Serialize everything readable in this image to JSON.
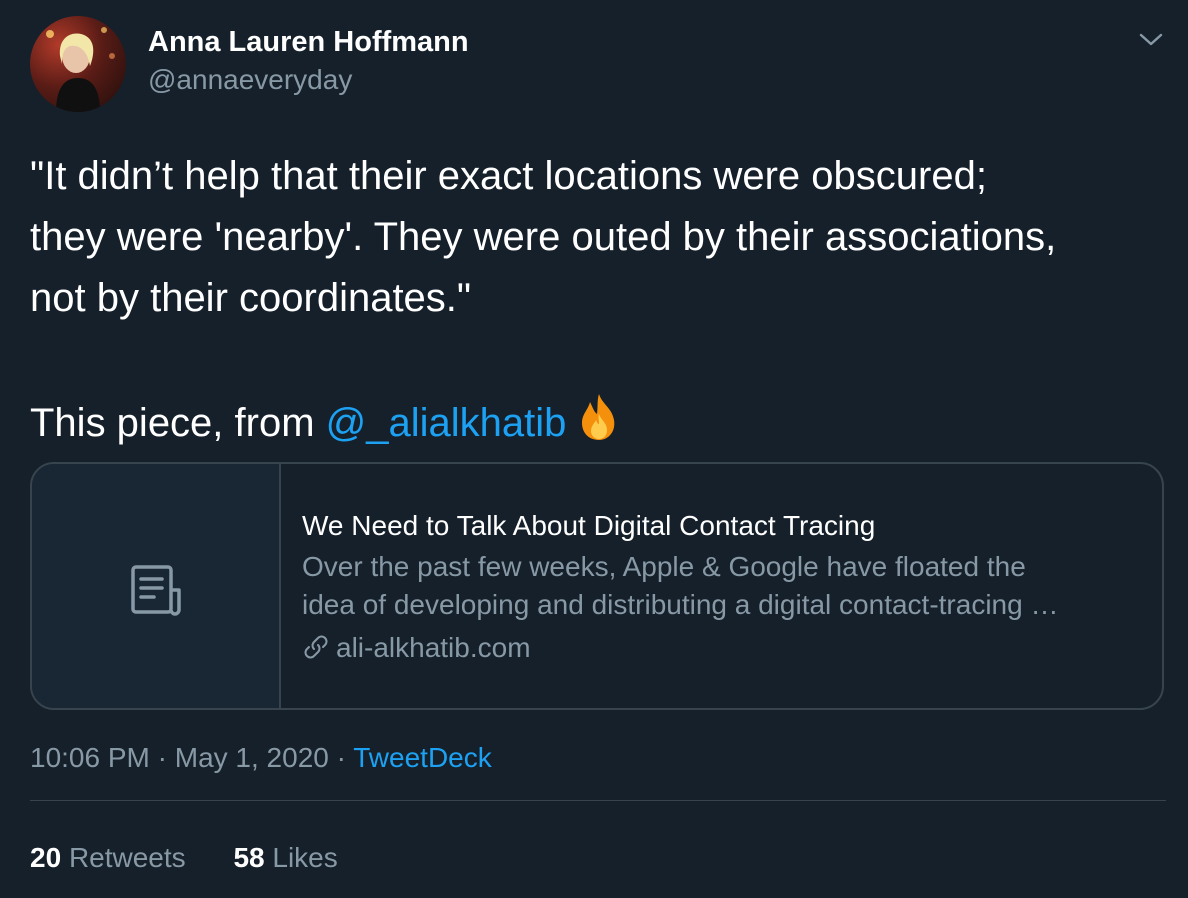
{
  "author": {
    "display_name": "Anna Lauren Hoffmann",
    "handle": "@annaeveryday"
  },
  "tweet": {
    "lines": [
      "\"It didn’t help that their exact locations were obscured;",
      "they were 'nearby'. They were outed by their associations,",
      "not by their coordinates.\""
    ],
    "second_paragraph_prefix": "This piece, from ",
    "mention": "@_alialkhatib",
    "emoji": "fire-icon"
  },
  "card": {
    "title": "We Need to Talk About Digital Contact Tracing",
    "description_lines": [
      "Over the past few weeks, Apple & Google have floated the",
      "idea of developing and distributing a digital contact-tracing …"
    ],
    "domain": "ali-alkhatib.com",
    "thumbnail_icon": "article-icon"
  },
  "meta": {
    "time": "10:06 PM",
    "separator": " · ",
    "date": "May 1, 2020",
    "source": "TweetDeck"
  },
  "stats": {
    "retweets_count": "20",
    "retweets_label": "Retweets",
    "likes_count": "58",
    "likes_label": "Likes"
  },
  "colors": {
    "background": "#15202b",
    "link": "#1da1f2",
    "secondary_text": "#8899a6",
    "border": "#38444d"
  }
}
